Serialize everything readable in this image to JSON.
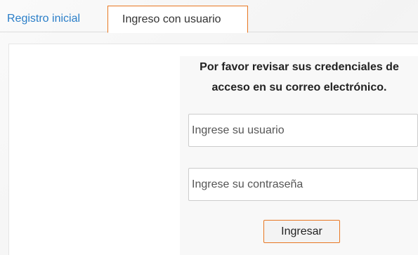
{
  "tabs": {
    "registro_label": "Registro inicial",
    "ingreso_label": "Ingreso con usuario"
  },
  "login": {
    "message_line1": "Por favor revisar sus credenciales de",
    "message_line2": "acceso en su correo electrónico.",
    "user_placeholder": "Ingrese su usuario",
    "password_placeholder": "Ingrese su contraseña",
    "submit_label": "Ingresar"
  },
  "colors": {
    "accent": "#e87722",
    "link": "#2a7ec8"
  }
}
